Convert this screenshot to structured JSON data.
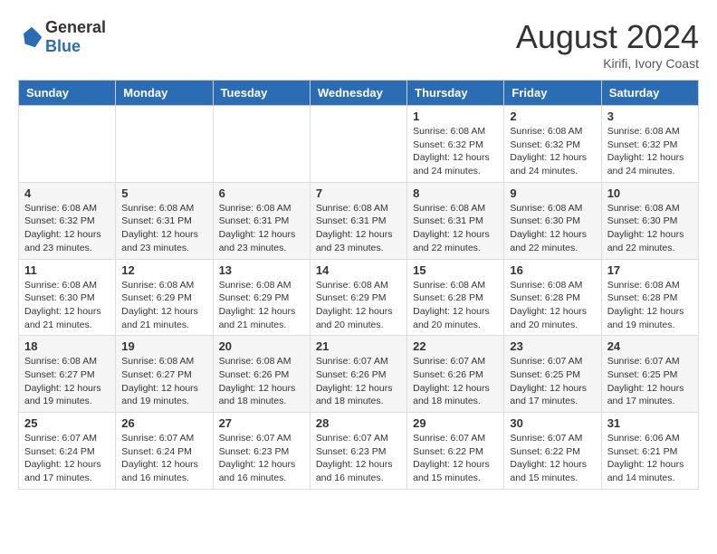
{
  "header": {
    "logo_general": "General",
    "logo_blue": "Blue",
    "month_year": "August 2024",
    "location": "Kirifi, Ivory Coast"
  },
  "days_of_week": [
    "Sunday",
    "Monday",
    "Tuesday",
    "Wednesday",
    "Thursday",
    "Friday",
    "Saturday"
  ],
  "weeks": [
    [
      {
        "day": "",
        "info": ""
      },
      {
        "day": "",
        "info": ""
      },
      {
        "day": "",
        "info": ""
      },
      {
        "day": "",
        "info": ""
      },
      {
        "day": "1",
        "info": "Sunrise: 6:08 AM\nSunset: 6:32 PM\nDaylight: 12 hours and 24 minutes."
      },
      {
        "day": "2",
        "info": "Sunrise: 6:08 AM\nSunset: 6:32 PM\nDaylight: 12 hours and 24 minutes."
      },
      {
        "day": "3",
        "info": "Sunrise: 6:08 AM\nSunset: 6:32 PM\nDaylight: 12 hours and 24 minutes."
      }
    ],
    [
      {
        "day": "4",
        "info": "Sunrise: 6:08 AM\nSunset: 6:32 PM\nDaylight: 12 hours and 23 minutes."
      },
      {
        "day": "5",
        "info": "Sunrise: 6:08 AM\nSunset: 6:31 PM\nDaylight: 12 hours and 23 minutes."
      },
      {
        "day": "6",
        "info": "Sunrise: 6:08 AM\nSunset: 6:31 PM\nDaylight: 12 hours and 23 minutes."
      },
      {
        "day": "7",
        "info": "Sunrise: 6:08 AM\nSunset: 6:31 PM\nDaylight: 12 hours and 23 minutes."
      },
      {
        "day": "8",
        "info": "Sunrise: 6:08 AM\nSunset: 6:31 PM\nDaylight: 12 hours and 22 minutes."
      },
      {
        "day": "9",
        "info": "Sunrise: 6:08 AM\nSunset: 6:30 PM\nDaylight: 12 hours and 22 minutes."
      },
      {
        "day": "10",
        "info": "Sunrise: 6:08 AM\nSunset: 6:30 PM\nDaylight: 12 hours and 22 minutes."
      }
    ],
    [
      {
        "day": "11",
        "info": "Sunrise: 6:08 AM\nSunset: 6:30 PM\nDaylight: 12 hours and 21 minutes."
      },
      {
        "day": "12",
        "info": "Sunrise: 6:08 AM\nSunset: 6:29 PM\nDaylight: 12 hours and 21 minutes."
      },
      {
        "day": "13",
        "info": "Sunrise: 6:08 AM\nSunset: 6:29 PM\nDaylight: 12 hours and 21 minutes."
      },
      {
        "day": "14",
        "info": "Sunrise: 6:08 AM\nSunset: 6:29 PM\nDaylight: 12 hours and 20 minutes."
      },
      {
        "day": "15",
        "info": "Sunrise: 6:08 AM\nSunset: 6:28 PM\nDaylight: 12 hours and 20 minutes."
      },
      {
        "day": "16",
        "info": "Sunrise: 6:08 AM\nSunset: 6:28 PM\nDaylight: 12 hours and 20 minutes."
      },
      {
        "day": "17",
        "info": "Sunrise: 6:08 AM\nSunset: 6:28 PM\nDaylight: 12 hours and 19 minutes."
      }
    ],
    [
      {
        "day": "18",
        "info": "Sunrise: 6:08 AM\nSunset: 6:27 PM\nDaylight: 12 hours and 19 minutes."
      },
      {
        "day": "19",
        "info": "Sunrise: 6:08 AM\nSunset: 6:27 PM\nDaylight: 12 hours and 19 minutes."
      },
      {
        "day": "20",
        "info": "Sunrise: 6:08 AM\nSunset: 6:26 PM\nDaylight: 12 hours and 18 minutes."
      },
      {
        "day": "21",
        "info": "Sunrise: 6:07 AM\nSunset: 6:26 PM\nDaylight: 12 hours and 18 minutes."
      },
      {
        "day": "22",
        "info": "Sunrise: 6:07 AM\nSunset: 6:26 PM\nDaylight: 12 hours and 18 minutes."
      },
      {
        "day": "23",
        "info": "Sunrise: 6:07 AM\nSunset: 6:25 PM\nDaylight: 12 hours and 17 minutes."
      },
      {
        "day": "24",
        "info": "Sunrise: 6:07 AM\nSunset: 6:25 PM\nDaylight: 12 hours and 17 minutes."
      }
    ],
    [
      {
        "day": "25",
        "info": "Sunrise: 6:07 AM\nSunset: 6:24 PM\nDaylight: 12 hours and 17 minutes."
      },
      {
        "day": "26",
        "info": "Sunrise: 6:07 AM\nSunset: 6:24 PM\nDaylight: 12 hours and 16 minutes."
      },
      {
        "day": "27",
        "info": "Sunrise: 6:07 AM\nSunset: 6:23 PM\nDaylight: 12 hours and 16 minutes."
      },
      {
        "day": "28",
        "info": "Sunrise: 6:07 AM\nSunset: 6:23 PM\nDaylight: 12 hours and 16 minutes."
      },
      {
        "day": "29",
        "info": "Sunrise: 6:07 AM\nSunset: 6:22 PM\nDaylight: 12 hours and 15 minutes."
      },
      {
        "day": "30",
        "info": "Sunrise: 6:07 AM\nSunset: 6:22 PM\nDaylight: 12 hours and 15 minutes."
      },
      {
        "day": "31",
        "info": "Sunrise: 6:06 AM\nSunset: 6:21 PM\nDaylight: 12 hours and 14 minutes."
      }
    ]
  ]
}
